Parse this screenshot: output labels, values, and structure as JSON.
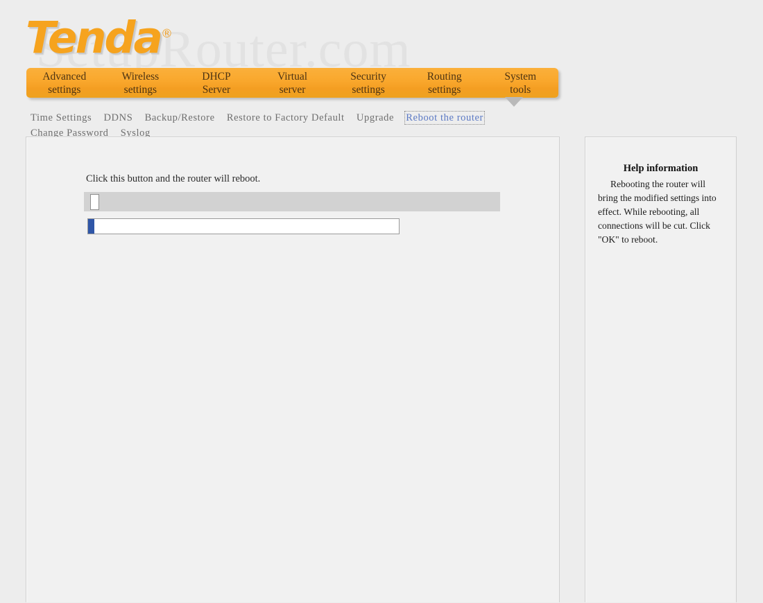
{
  "brand": {
    "logo_text": "Tenda",
    "registered_mark": "®",
    "watermark": "SetupRouter.com"
  },
  "main_nav": {
    "items": [
      {
        "label": "Advanced\nsettings"
      },
      {
        "label": "Wireless\nsettings"
      },
      {
        "label": "DHCP\nServer"
      },
      {
        "label": "Virtual\nserver"
      },
      {
        "label": "Security\nsettings"
      },
      {
        "label": "Routing\nsettings"
      },
      {
        "label": "System\ntools"
      }
    ],
    "active_index": 6,
    "background_color": "#f9a72c",
    "text_color": "#4c3312",
    "pointer_color": "#b9b9b9"
  },
  "sub_nav": {
    "items": [
      {
        "label": "Time Settings",
        "active": false
      },
      {
        "label": "DDNS",
        "active": false
      },
      {
        "label": "Backup/Restore",
        "active": false
      },
      {
        "label": "Restore to Factory Default",
        "active": false
      },
      {
        "label": "Upgrade",
        "active": false
      },
      {
        "label": "Reboot the router",
        "active": true
      },
      {
        "label": "Change Password",
        "active": false
      },
      {
        "label": "Syslog",
        "active": false
      }
    ],
    "active_color": "#5b79c4",
    "inactive_color": "#6e6e6e"
  },
  "content": {
    "instruction": "Click this button and the router will reboot.",
    "reboot_button_label": "",
    "button_bar_color": "#d2d2d2",
    "progress": {
      "percent": 2,
      "fill_color": "#2f56a7"
    }
  },
  "help": {
    "title": "Help information",
    "body": "Rebooting the router will bring the modified settings into effect. While rebooting, all connections will be cut. Click \"OK\" to reboot."
  }
}
